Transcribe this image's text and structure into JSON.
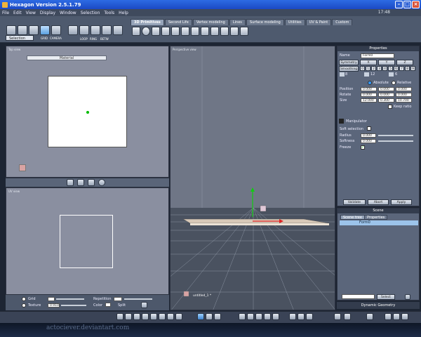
{
  "window": {
    "title": "Hexagon Version 2.5.1.79",
    "clock": "17:48"
  },
  "menu": [
    "File",
    "Edit",
    "View",
    "Display",
    "Window",
    "Selection",
    "Tools",
    "Help"
  ],
  "toolbar": {
    "selection_label": "Selection",
    "grid_label": "GRID",
    "camera_label": "CAMERA",
    "loop_label": "LOOP",
    "ring_label": "RING",
    "betw_label": "BETW"
  },
  "tabs": [
    "3D Primitives",
    "Second Life",
    "Vertex modeling",
    "Lines",
    "Surface modeling",
    "Utilities",
    "UV & Paint",
    "Custom"
  ],
  "active_tab": "3D Primitives",
  "views": {
    "top": {
      "label": "Top view",
      "material": "Material"
    },
    "uv": {
      "label": "UV view"
    },
    "perspective": {
      "label": "Perspective view",
      "object_label": "untitled_1 *"
    }
  },
  "uv_controls": {
    "grid": "Grid",
    "texture": "Texture",
    "texture_value": "0.910",
    "repetition": "Repetition",
    "color": "Color",
    "split": "Split"
  },
  "properties": {
    "header": "Properties",
    "name_label": "Name",
    "name_value": "Form0",
    "symmetry": "Symmetry",
    "sym_axes": [
      "X",
      "Y",
      "Z"
    ],
    "smoothing": "Smoothing",
    "smoothing_levels": [
      "0",
      "1",
      "2",
      "3",
      "4",
      "5",
      "6",
      "7",
      "8",
      "9"
    ],
    "counts": [
      "8",
      "12",
      "6"
    ],
    "absolute": "Absolute",
    "relative": "Relative",
    "position_label": "Position",
    "position": [
      "0.000",
      "0.000",
      "0.000"
    ],
    "rotate_label": "Rotate",
    "rotate": [
      "0.000",
      "0.000",
      "0.000"
    ],
    "size_label": "Size",
    "size": [
      "12.000",
      "0.300",
      "10.700"
    ],
    "keep_ratio": "Keep ratio",
    "manipulator": "Manipulator",
    "soft_selection": "Soft selection",
    "radius_label": "Radius",
    "radius": "0.000",
    "softness_label": "Softness",
    "softness": "0.000",
    "freeze": "Freeze",
    "validate": "Validate",
    "abort": "Abort",
    "apply": "Apply"
  },
  "scene": {
    "header": "Scene",
    "tab_tree": "Scene tree",
    "tab_props": "Properties",
    "item": "Form0",
    "select": "Select"
  },
  "dynamic": {
    "header": "Dynamic Geometry"
  },
  "watermark": "actociever.deviantart.com",
  "colors": {
    "titlebar": "#2d6be3",
    "panel": "#5b667b",
    "viewport": "#8a8fa0",
    "selection": "#9cc3ea"
  }
}
